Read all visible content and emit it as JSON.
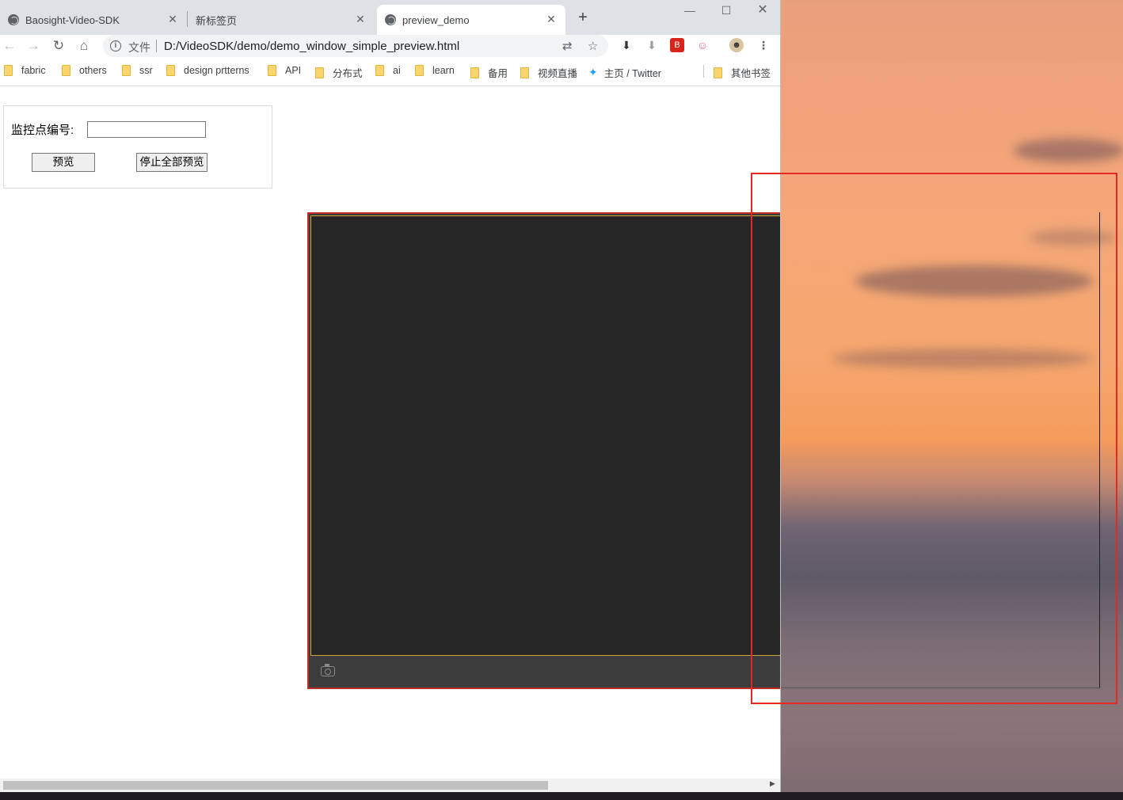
{
  "tabs": [
    {
      "title": "Baosight-Video-SDK",
      "icon": "globe-icon",
      "active": false
    },
    {
      "title": "新标签页",
      "icon": "",
      "active": false
    },
    {
      "title": "preview_demo",
      "icon": "globe-icon",
      "active": true
    }
  ],
  "window_controls": {
    "minimize": "—",
    "maximize": "☐",
    "close": "✕"
  },
  "address_bar": {
    "scheme_label": "文件",
    "url": "D:/VideoSDK/demo/demo_window_simple_preview.html"
  },
  "bookmarks": [
    "fabric",
    "others",
    "ssr",
    "design prtterns",
    "API",
    "分布式",
    "ai",
    "learn",
    "备用",
    "视频直播",
    "主页 / Twitter"
  ],
  "other_bookmarks": "其他书签",
  "form": {
    "label": "监控点编号:",
    "input_value": "",
    "preview_button": "预览",
    "stop_all_button": "停止全部预览"
  },
  "colors": {
    "player_border": "#c32a23",
    "overlay_rect": "#e8281f",
    "video_bg": "#262626"
  }
}
